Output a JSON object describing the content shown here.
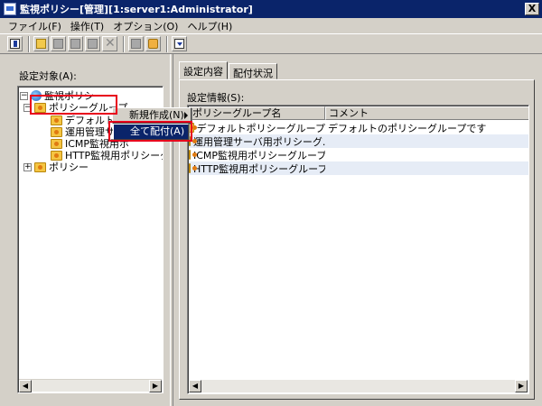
{
  "window": {
    "title": "監視ポリシー[管理][1:server1:Administrator]",
    "close_label": "X"
  },
  "menubar": {
    "items": [
      {
        "label": "ファイル(F)"
      },
      {
        "label": "操作(T)"
      },
      {
        "label": "オプション(O)"
      },
      {
        "label": "ヘルプ(H)"
      }
    ]
  },
  "toolbar": {
    "buttons": [
      "exit-icon",
      "new-folder-icon",
      "edit-icon",
      "copy-icon",
      "paste-icon",
      "delete-icon",
      "distribute-icon",
      "package-icon",
      "download-icon"
    ]
  },
  "left": {
    "label": "設定対象(A):",
    "tree": [
      {
        "label": "監視ポリシー",
        "icon": "globe-icon",
        "expander": "−"
      },
      {
        "label": "ポリシーグループ",
        "icon": "folder-icon",
        "expander": "−"
      },
      {
        "label": "デフォルトポ",
        "icon": "folder-icon"
      },
      {
        "label": "運用管理サー",
        "icon": "folder-icon"
      },
      {
        "label": "ICMP監視用ポ",
        "icon": "folder-icon"
      },
      {
        "label": "HTTP監視用ポリシーグルー",
        "icon": "folder-icon"
      },
      {
        "label": "ポリシー",
        "icon": "folder-icon",
        "expander": "+"
      }
    ]
  },
  "context_menu": {
    "items": [
      {
        "label": "新規作成(N)"
      }
    ],
    "submenu": {
      "items": [
        {
          "label": "全て配付(A)"
        }
      ]
    }
  },
  "right": {
    "tabs": [
      {
        "label": "設定内容"
      },
      {
        "label": "配付状況"
      }
    ],
    "label": "設定情報(S):",
    "columns": [
      {
        "label": "ポリシーグループ名"
      },
      {
        "label": "コメント"
      }
    ],
    "rows": [
      {
        "name": "デフォルトポリシーグループ",
        "comment": "デフォルトのポリシーグループです"
      },
      {
        "name": "運用管理サーバ用ポリシーグ...",
        "comment": ""
      },
      {
        "name": "ICMP監視用ポリシーグループ",
        "comment": ""
      },
      {
        "name": "HTTP監視用ポリシーグループ",
        "comment": ""
      }
    ]
  },
  "colors": {
    "titlebar": "#0a246a",
    "highlight": "#0a246a",
    "annotation": "#e8001c"
  }
}
